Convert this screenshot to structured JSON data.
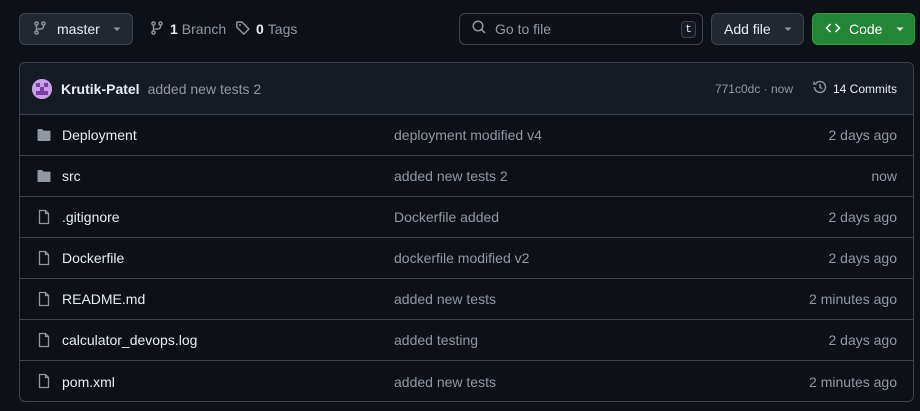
{
  "colors": {
    "background": "#0d1117",
    "border": "#3d444d",
    "button_bg": "#212830",
    "code_button_bg": "#238636",
    "text_primary": "#e6edf3",
    "text_muted": "#9198a1",
    "folder_icon": "#9198a1"
  },
  "toolbar": {
    "branch_name": "master",
    "branch_count": "1",
    "branch_label": "Branch",
    "tag_count": "0",
    "tag_label": "Tags",
    "search_placeholder": "Go to file",
    "search_shortcut": "t",
    "add_file_label": "Add file",
    "code_label": "Code"
  },
  "latest_commit": {
    "author": "Krutik-Patel",
    "message": "added new tests 2",
    "hash_time": "771c0dc · now",
    "commit_count_label": "14 Commits"
  },
  "files": [
    {
      "type": "folder",
      "icon": "folder-icon",
      "name": "Deployment",
      "message": "deployment modified v4",
      "age": "2 days ago"
    },
    {
      "type": "folder",
      "icon": "folder-icon",
      "name": "src",
      "message": "added new tests 2",
      "age": "now"
    },
    {
      "type": "file",
      "icon": "file-icon",
      "name": ".gitignore",
      "message": "Dockerfile added",
      "age": "2 days ago"
    },
    {
      "type": "file",
      "icon": "file-icon",
      "name": "Dockerfile",
      "message": "dockerfile modified v2",
      "age": "2 days ago"
    },
    {
      "type": "file",
      "icon": "file-icon",
      "name": "README.md",
      "message": "added new tests",
      "age": "2 minutes ago"
    },
    {
      "type": "file",
      "icon": "file-icon",
      "name": "calculator_devops.log",
      "message": "added testing",
      "age": "2 days ago"
    },
    {
      "type": "file",
      "icon": "file-icon",
      "name": "pom.xml",
      "message": "added new tests",
      "age": "2 minutes ago"
    }
  ]
}
